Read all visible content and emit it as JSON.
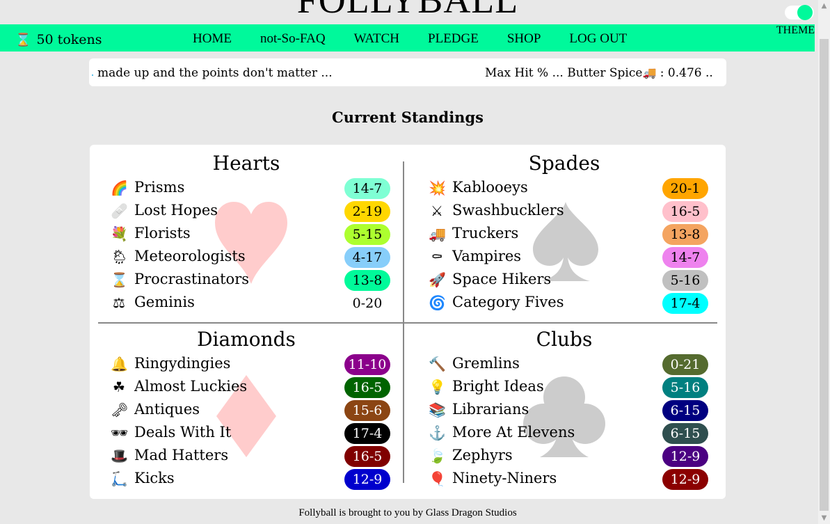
{
  "site": {
    "title": "FOLLYBALL",
    "theme_label": "THEME",
    "theme_toggle_on": true
  },
  "navbar": {
    "tokens_icon": "hourglass-icon",
    "tokens_glyph": "⌛",
    "tokens_label": "50 tokens",
    "links": [
      "HOME",
      "not-So-FAQ",
      "WATCH",
      "PLEDGE",
      "SHOP",
      "LOG OUT"
    ]
  },
  "ticker": {
    "left_text": "made up and the points don't matter ...",
    "right_text_before": "Max Hit % ... Butter Spice",
    "right_icon": "truck-icon",
    "right_glyph": "🚚",
    "right_text_after": " : 0.476 .."
  },
  "standings": {
    "title": "Current Standings",
    "divisions": [
      {
        "name": "Hearts",
        "suit": "heart",
        "suit_color": "#ffcccc",
        "teams": [
          {
            "emoji": "🌈",
            "icon": "rainbow-icon",
            "name": "Prisms",
            "record": "14-7",
            "bg": "#7fffd4",
            "fg": "#000000"
          },
          {
            "emoji": "🩹",
            "icon": "bandage-icon",
            "name": "Lost Hopes",
            "record": "2-19",
            "bg": "#ffd700",
            "fg": "#000000"
          },
          {
            "emoji": "💐",
            "icon": "bouquet-icon",
            "name": "Florists",
            "record": "5-15",
            "bg": "#adff2f",
            "fg": "#000000"
          },
          {
            "emoji": "🌦",
            "icon": "sun-rain-cloud-icon",
            "name": "Meteorologists",
            "record": "4-17",
            "bg": "#87cefa",
            "fg": "#000000"
          },
          {
            "emoji": "⌛",
            "icon": "hourglass-icon",
            "name": "Procrastinators",
            "record": "13-8",
            "bg": "#00fa9a",
            "fg": "#000000"
          },
          {
            "emoji": "⚖",
            "icon": "scales-icon",
            "name": "Geminis",
            "record": "0-20",
            "bg": "transparent",
            "fg": "#000000"
          }
        ]
      },
      {
        "name": "Spades",
        "suit": "spade",
        "suit_color": "#cccccc",
        "teams": [
          {
            "emoji": "💥",
            "icon": "explosion-icon",
            "name": "Kablooeys",
            "record": "20-1",
            "bg": "#ffa500",
            "fg": "#000000"
          },
          {
            "emoji": "⚔",
            "icon": "crossed-swords-icon",
            "name": "Swashbucklers",
            "record": "16-5",
            "bg": "#ffc0cb",
            "fg": "#000000"
          },
          {
            "emoji": "🚚",
            "icon": "truck-icon",
            "name": "Truckers",
            "record": "13-8",
            "bg": "#f4a460",
            "fg": "#000000"
          },
          {
            "emoji": "⚰",
            "icon": "coffin-icon",
            "name": "Vampires",
            "record": "14-7",
            "bg": "#ee82ee",
            "fg": "#000000"
          },
          {
            "emoji": "🚀",
            "icon": "rocket-icon",
            "name": "Space Hikers",
            "record": "5-16",
            "bg": "#c0c0c0",
            "fg": "#000000"
          },
          {
            "emoji": "🌀",
            "icon": "cyclone-icon",
            "name": "Category Fives",
            "record": "17-4",
            "bg": "#00ffff",
            "fg": "#000000"
          }
        ]
      },
      {
        "name": "Diamonds",
        "suit": "diamond",
        "suit_color": "#ffcccc",
        "teams": [
          {
            "emoji": "🔔",
            "icon": "bell-icon",
            "name": "Ringydingies",
            "record": "11-10",
            "bg": "#8b008b",
            "fg": "#ffffff"
          },
          {
            "emoji": "☘",
            "icon": "shamrock-icon",
            "name": "Almost Luckies",
            "record": "16-5",
            "bg": "#006400",
            "fg": "#ffffff"
          },
          {
            "emoji": "🗝",
            "icon": "old-key-icon",
            "name": "Antiques",
            "record": "15-6",
            "bg": "#8b4513",
            "fg": "#ffffff"
          },
          {
            "emoji": "🕶",
            "icon": "sunglasses-icon",
            "name": "Deals With It",
            "record": "17-4",
            "bg": "#000000",
            "fg": "#ffffff"
          },
          {
            "emoji": "🎩",
            "icon": "top-hat-icon",
            "name": "Mad Hatters",
            "record": "16-5",
            "bg": "#800000",
            "fg": "#ffffff"
          },
          {
            "emoji": "🛴",
            "icon": "kick-scooter-icon",
            "name": "Kicks",
            "record": "12-9",
            "bg": "#0000cd",
            "fg": "#ffffff"
          }
        ]
      },
      {
        "name": "Clubs",
        "suit": "club",
        "suit_color": "#cccccc",
        "teams": [
          {
            "emoji": "🔨",
            "icon": "hammer-icon",
            "name": "Gremlins",
            "record": "0-21",
            "bg": "#556b2f",
            "fg": "#ffffff"
          },
          {
            "emoji": "💡",
            "icon": "light-bulb-icon",
            "name": "Bright Ideas",
            "record": "5-16",
            "bg": "#008080",
            "fg": "#ffffff"
          },
          {
            "emoji": "📚",
            "icon": "books-icon",
            "name": "Librarians",
            "record": "6-15",
            "bg": "#000080",
            "fg": "#ffffff"
          },
          {
            "emoji": "⚓",
            "icon": "anchor-icon",
            "name": "More At Elevens",
            "record": "6-15",
            "bg": "#2f4f4f",
            "fg": "#ffffff"
          },
          {
            "emoji": "🍃",
            "icon": "leaf-wind-icon",
            "name": "Zephyrs",
            "record": "12-9",
            "bg": "#4b0082",
            "fg": "#ffffff"
          },
          {
            "emoji": "🎈",
            "icon": "balloon-icon",
            "name": "Ninety-Niners",
            "record": "12-9",
            "bg": "#8b0000",
            "fg": "#ffffff"
          }
        ]
      }
    ]
  },
  "footer": {
    "text": "Follyball is brought to you by Glass Dragon Studios"
  }
}
